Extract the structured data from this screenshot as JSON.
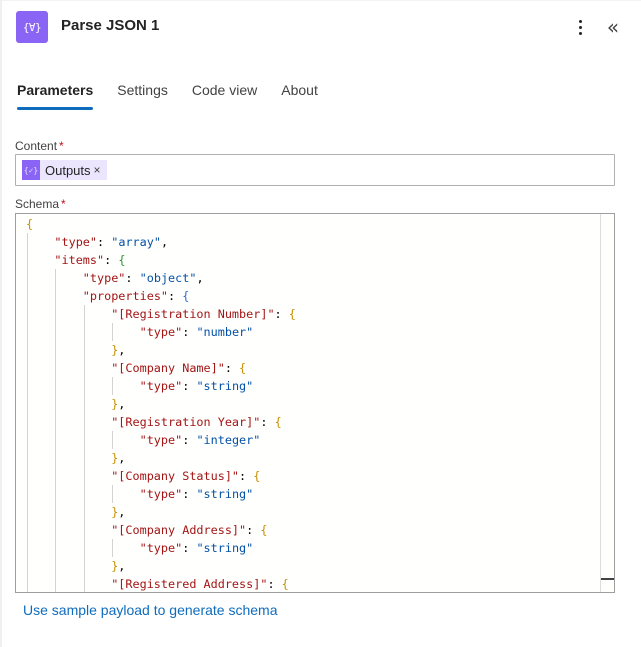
{
  "header": {
    "icon": "parse-json-icon",
    "icon_glyph": "{∀}",
    "title": "Parse JSON 1",
    "more_icon": "more-vertical-icon",
    "collapse_icon": "chevron-double-left-icon",
    "collapse_glyph": "«"
  },
  "tabs": [
    {
      "label": "Parameters",
      "active": true
    },
    {
      "label": "Settings",
      "active": false
    },
    {
      "label": "Code view",
      "active": false
    },
    {
      "label": "About",
      "active": false
    }
  ],
  "content": {
    "label": "Content",
    "required_mark": "*",
    "token": {
      "icon": "expression-icon",
      "icon_glyph": "{✓}",
      "label": "Outputs",
      "remove_glyph": "×"
    }
  },
  "schema": {
    "label": "Schema",
    "required_mark": "*",
    "lines": [
      {
        "indent": 0,
        "parts": [
          [
            "b1",
            "{"
          ]
        ]
      },
      {
        "indent": 1,
        "parts": [
          [
            "k",
            "\"type\""
          ],
          [
            "p",
            ": "
          ],
          [
            "s",
            "\"array\""
          ],
          [
            "p",
            ","
          ]
        ]
      },
      {
        "indent": 1,
        "parts": [
          [
            "k",
            "\"items\""
          ],
          [
            "p",
            ": "
          ],
          [
            "b2",
            "{"
          ]
        ]
      },
      {
        "indent": 2,
        "parts": [
          [
            "k",
            "\"type\""
          ],
          [
            "p",
            ": "
          ],
          [
            "s",
            "\"object\""
          ],
          [
            "p",
            ","
          ]
        ]
      },
      {
        "indent": 2,
        "parts": [
          [
            "k",
            "\"properties\""
          ],
          [
            "p",
            ": "
          ],
          [
            "b3",
            "{"
          ]
        ]
      },
      {
        "indent": 3,
        "parts": [
          [
            "k",
            "\"[Registration Number]\""
          ],
          [
            "p",
            ": "
          ],
          [
            "b1",
            "{"
          ]
        ]
      },
      {
        "indent": 4,
        "parts": [
          [
            "k",
            "\"type\""
          ],
          [
            "p",
            ": "
          ],
          [
            "s",
            "\"number\""
          ]
        ]
      },
      {
        "indent": 3,
        "parts": [
          [
            "b1",
            "}"
          ],
          [
            "p",
            ","
          ]
        ]
      },
      {
        "indent": 3,
        "parts": [
          [
            "k",
            "\"[Company Name]\""
          ],
          [
            "p",
            ": "
          ],
          [
            "b1",
            "{"
          ]
        ]
      },
      {
        "indent": 4,
        "parts": [
          [
            "k",
            "\"type\""
          ],
          [
            "p",
            ": "
          ],
          [
            "s",
            "\"string\""
          ]
        ]
      },
      {
        "indent": 3,
        "parts": [
          [
            "b1",
            "}"
          ],
          [
            "p",
            ","
          ]
        ]
      },
      {
        "indent": 3,
        "parts": [
          [
            "k",
            "\"[Registration Year]\""
          ],
          [
            "p",
            ": "
          ],
          [
            "b1",
            "{"
          ]
        ]
      },
      {
        "indent": 4,
        "parts": [
          [
            "k",
            "\"type\""
          ],
          [
            "p",
            ": "
          ],
          [
            "s",
            "\"integer\""
          ]
        ]
      },
      {
        "indent": 3,
        "parts": [
          [
            "b1",
            "}"
          ],
          [
            "p",
            ","
          ]
        ]
      },
      {
        "indent": 3,
        "parts": [
          [
            "k",
            "\"[Company Status]\""
          ],
          [
            "p",
            ": "
          ],
          [
            "b1",
            "{"
          ]
        ]
      },
      {
        "indent": 4,
        "parts": [
          [
            "k",
            "\"type\""
          ],
          [
            "p",
            ": "
          ],
          [
            "s",
            "\"string\""
          ]
        ]
      },
      {
        "indent": 3,
        "parts": [
          [
            "b1",
            "}"
          ],
          [
            "p",
            ","
          ]
        ]
      },
      {
        "indent": 3,
        "parts": [
          [
            "k",
            "\"[Company Address]\""
          ],
          [
            "p",
            ": "
          ],
          [
            "b1",
            "{"
          ]
        ]
      },
      {
        "indent": 4,
        "parts": [
          [
            "k",
            "\"type\""
          ],
          [
            "p",
            ": "
          ],
          [
            "s",
            "\"string\""
          ]
        ]
      },
      {
        "indent": 3,
        "parts": [
          [
            "b1",
            "}"
          ],
          [
            "p",
            ","
          ]
        ]
      },
      {
        "indent": 3,
        "parts": [
          [
            "k",
            "\"[Registered Address]\""
          ],
          [
            "p",
            ": "
          ],
          [
            "b1",
            "{"
          ]
        ]
      }
    ]
  },
  "footer": {
    "link": "Use sample payload to generate schema"
  },
  "colors": {
    "accent": "#0f6cbd",
    "action_icon_bg": "#8a64f5",
    "token_bg": "#ebe5fd",
    "required": "#c50f1f",
    "json_key": "#a31515",
    "json_string": "#0451a5"
  }
}
